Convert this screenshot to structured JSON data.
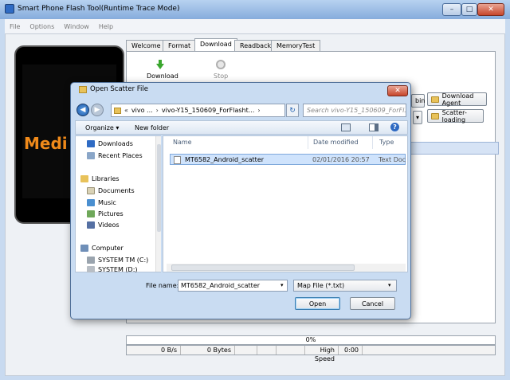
{
  "window": {
    "title": "Smart Phone Flash Tool(Runtime Trace Mode)",
    "min": "–",
    "max": "□",
    "close": "✕"
  },
  "menu": [
    "File",
    "Options",
    "Window",
    "Help"
  ],
  "splash": {
    "text": "Medi"
  },
  "tabs": [
    "Welcome",
    "Format",
    "Download",
    "Readback",
    "MemoryTest"
  ],
  "active_tab": "Download",
  "toolbar": {
    "download": "Download",
    "stop": "Stop"
  },
  "right_buttons": {
    "download_agent": "Download Agent",
    "scatter_loading": "Scatter-loading",
    "partial": "bin"
  },
  "status": {
    "progress": "0%",
    "speed": "0 B/s",
    "bytes": "0 Bytes",
    "mode": "High Speed",
    "time": "0:00"
  },
  "dialog": {
    "title": "Open Scatter File",
    "close": "✕",
    "path": [
      "«",
      "vivo ...",
      "›",
      "vivo-Y15_150609_ForFlasht...",
      "›"
    ],
    "search_placeholder": "Search vivo-Y15_150609_ForFl...",
    "organize": "Organize ▾",
    "new_folder": "New folder",
    "help": "?",
    "nav": [
      {
        "label": "Downloads",
        "icon": "downloads-folder-icon",
        "color": "#2f6bc4"
      },
      {
        "label": "Recent Places",
        "icon": "recent-places-icon",
        "color": "#8aa6c8"
      },
      {
        "label": "Libraries",
        "icon": "libraries-icon",
        "color": "#e8c25a"
      },
      {
        "label": "Documents",
        "icon": "documents-icon",
        "color": "#d9d2b6"
      },
      {
        "label": "Music",
        "icon": "music-icon",
        "color": "#4a8fd0"
      },
      {
        "label": "Pictures",
        "icon": "pictures-icon",
        "color": "#6fa85a"
      },
      {
        "label": "Videos",
        "icon": "videos-icon",
        "color": "#5570a3"
      },
      {
        "label": "Computer",
        "icon": "computer-icon",
        "color": "#6f8fb8"
      },
      {
        "label": "SYSTEM TM (C:)",
        "icon": "drive-c-icon",
        "color": "#9aa4ae"
      },
      {
        "label": "SYSTEM (D:)",
        "icon": "drive-d-icon",
        "color": "#b8bec5"
      }
    ],
    "columns": [
      "Name",
      "Date modified",
      "Type"
    ],
    "files": [
      {
        "name": "MT6582_Android_scatter",
        "date": "02/01/2016 20:57",
        "type": "Text Document"
      }
    ],
    "file_name_label": "File name:",
    "file_name_value": "MT6582_Android_scatter",
    "filter_value": "Map File (*.txt)",
    "open": "Open",
    "cancel": "Cancel"
  }
}
